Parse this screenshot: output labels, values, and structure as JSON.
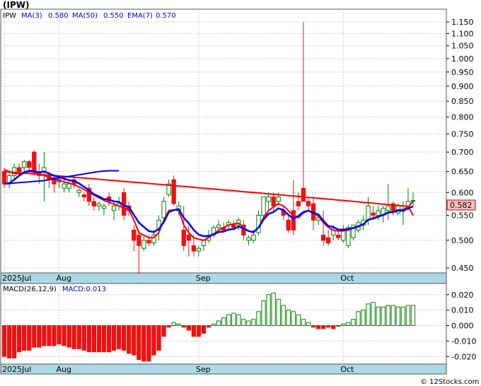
{
  "header": {
    "title": "(IPW)"
  },
  "legend": {
    "symbol": "IPW",
    "items": [
      {
        "label": "MA(3)",
        "value": "0.580",
        "color": "#ff0000"
      },
      {
        "label": "MA(50)",
        "value": "0.550",
        "color": "#0000cc"
      },
      {
        "label": "EMA(7)",
        "value": "0.570",
        "color": "#0000cc"
      }
    ]
  },
  "macd_legend": {
    "label": "MACD(26,12,9)",
    "value_label": "MACD:0.013"
  },
  "last_price": {
    "text": "0.582",
    "bg": "#ffc0c0"
  },
  "watermark": "© 12Stocks.com",
  "colors": {
    "up": "#008000",
    "down": "#ee1111",
    "ma": "#ff0000",
    "ema": "#0000ff",
    "axis_bar": "#add8e6"
  },
  "chart_data": [
    {
      "type": "candlestick",
      "title": "(IPW)",
      "ylim": [
        0.43,
        1.16
      ],
      "y_scale": "log",
      "y_ticks": [
        "1.150",
        "1.100",
        "1.050",
        "1.000",
        "0.950",
        "0.900",
        "0.850",
        "0.800",
        "0.750",
        "0.700",
        "0.650",
        "0.600",
        "0.550",
        "0.500",
        "0.450"
      ],
      "x_labels": [
        "2025Jul",
        "Aug",
        "Sep",
        "Oct"
      ],
      "x_label_index": [
        0,
        11,
        39,
        68
      ],
      "candles": [
        [
          0.65,
          0.66,
          0.61,
          0.62
        ],
        [
          0.62,
          0.65,
          0.61,
          0.64
        ],
        [
          0.64,
          0.67,
          0.63,
          0.66
        ],
        [
          0.66,
          0.67,
          0.64,
          0.65
        ],
        [
          0.66,
          0.68,
          0.65,
          0.675
        ],
        [
          0.675,
          0.68,
          0.65,
          0.66
        ],
        [
          0.7,
          0.705,
          0.64,
          0.65
        ],
        [
          0.65,
          0.67,
          0.62,
          0.64
        ],
        [
          0.65,
          0.7,
          0.58,
          0.66
        ],
        [
          0.64,
          0.65,
          0.61,
          0.63
        ],
        [
          0.635,
          0.64,
          0.6,
          0.62
        ],
        [
          0.625,
          0.64,
          0.61,
          0.63
        ],
        [
          0.61,
          0.63,
          0.6,
          0.62
        ],
        [
          0.61,
          0.63,
          0.6,
          0.62
        ],
        [
          0.63,
          0.64,
          0.61,
          0.62
        ],
        [
          0.6,
          0.61,
          0.59,
          0.605
        ],
        [
          0.595,
          0.6,
          0.58,
          0.59
        ],
        [
          0.61,
          0.62,
          0.57,
          0.58
        ],
        [
          0.58,
          0.59,
          0.56,
          0.57
        ],
        [
          0.57,
          0.58,
          0.56,
          0.575
        ],
        [
          0.565,
          0.575,
          0.55,
          0.57
        ],
        [
          0.59,
          0.6,
          0.57,
          0.58
        ],
        [
          0.56,
          0.58,
          0.54,
          0.57
        ],
        [
          0.57,
          0.59,
          0.56,
          0.575
        ],
        [
          0.6,
          0.61,
          0.54,
          0.55
        ],
        [
          0.57,
          0.58,
          0.55,
          0.56
        ],
        [
          0.52,
          0.53,
          0.48,
          0.5
        ],
        [
          0.51,
          0.52,
          0.44,
          0.49
        ],
        [
          0.485,
          0.51,
          0.48,
          0.5
        ],
        [
          0.5,
          0.51,
          0.49,
          0.495
        ],
        [
          0.495,
          0.52,
          0.49,
          0.51
        ],
        [
          0.52,
          0.55,
          0.5,
          0.54
        ],
        [
          0.545,
          0.59,
          0.54,
          0.58
        ],
        [
          0.595,
          0.63,
          0.59,
          0.62
        ],
        [
          0.63,
          0.64,
          0.57,
          0.575
        ],
        [
          0.56,
          0.58,
          0.55,
          0.57
        ],
        [
          0.52,
          0.57,
          0.48,
          0.49
        ],
        [
          0.51,
          0.53,
          0.47,
          0.5
        ],
        [
          0.49,
          0.51,
          0.47,
          0.48
        ],
        [
          0.48,
          0.49,
          0.47,
          0.485
        ],
        [
          0.49,
          0.5,
          0.48,
          0.5
        ],
        [
          0.5,
          0.52,
          0.495,
          0.51
        ],
        [
          0.51,
          0.53,
          0.505,
          0.525
        ],
        [
          0.525,
          0.54,
          0.52,
          0.53
        ],
        [
          0.525,
          0.535,
          0.515,
          0.52
        ],
        [
          0.53,
          0.54,
          0.52,
          0.535
        ],
        [
          0.53,
          0.54,
          0.52,
          0.525
        ],
        [
          0.53,
          0.545,
          0.52,
          0.54
        ],
        [
          0.53,
          0.54,
          0.5,
          0.51
        ],
        [
          0.5,
          0.51,
          0.49,
          0.505
        ],
        [
          0.5,
          0.52,
          0.495,
          0.51
        ],
        [
          0.515,
          0.56,
          0.51,
          0.55
        ],
        [
          0.55,
          0.59,
          0.545,
          0.59
        ],
        [
          0.58,
          0.6,
          0.56,
          0.59
        ],
        [
          0.59,
          0.6,
          0.56,
          0.57
        ],
        [
          0.58,
          0.6,
          0.57,
          0.59
        ],
        [
          0.56,
          0.57,
          0.54,
          0.55
        ],
        [
          0.54,
          0.55,
          0.515,
          0.52
        ],
        [
          0.56,
          0.63,
          0.51,
          0.52
        ],
        [
          0.58,
          0.6,
          0.56,
          0.57
        ],
        [
          0.61,
          1.15,
          0.58,
          0.58
        ],
        [
          0.58,
          0.59,
          0.56,
          0.57
        ],
        [
          0.575,
          0.59,
          0.52,
          0.54
        ],
        [
          0.54,
          0.55,
          0.53,
          0.545
        ],
        [
          0.51,
          0.56,
          0.49,
          0.5
        ],
        [
          0.505,
          0.52,
          0.49,
          0.495
        ],
        [
          0.51,
          0.53,
          0.5,
          0.52
        ],
        [
          0.51,
          0.52,
          0.5,
          0.505
        ],
        [
          0.5,
          0.53,
          0.495,
          0.52
        ],
        [
          0.49,
          0.53,
          0.485,
          0.525
        ],
        [
          0.505,
          0.53,
          0.5,
          0.53
        ],
        [
          0.52,
          0.54,
          0.515,
          0.535
        ],
        [
          0.53,
          0.55,
          0.52,
          0.54
        ],
        [
          0.54,
          0.59,
          0.53,
          0.57
        ],
        [
          0.555,
          0.57,
          0.545,
          0.55
        ],
        [
          0.55,
          0.57,
          0.54,
          0.56
        ],
        [
          0.55,
          0.57,
          0.535,
          0.565
        ],
        [
          0.56,
          0.62,
          0.54,
          0.57
        ],
        [
          0.575,
          0.58,
          0.55,
          0.56
        ],
        [
          0.555,
          0.575,
          0.55,
          0.57
        ],
        [
          0.56,
          0.58,
          0.53,
          0.56
        ],
        [
          0.57,
          0.61,
          0.56,
          0.58
        ],
        [
          0.582,
          0.6,
          0.57,
          0.582
        ]
      ],
      "ema7": [
        0.62,
        0.622,
        0.63,
        0.64,
        0.648,
        0.652,
        0.651,
        0.648,
        0.65,
        0.645,
        0.64,
        0.637,
        0.632,
        0.629,
        0.627,
        0.621,
        0.613,
        0.605,
        0.596,
        0.591,
        0.585,
        0.584,
        0.58,
        0.579,
        0.571,
        0.568,
        0.551,
        0.535,
        0.526,
        0.518,
        0.516,
        0.522,
        0.536,
        0.557,
        0.561,
        0.563,
        0.545,
        0.534,
        0.52,
        0.511,
        0.508,
        0.508,
        0.512,
        0.516,
        0.517,
        0.521,
        0.522,
        0.527,
        0.523,
        0.518,
        0.516,
        0.525,
        0.541,
        0.553,
        0.557,
        0.565,
        0.561,
        0.551,
        0.543,
        0.549,
        0.557,
        0.56,
        0.555,
        0.552,
        0.539,
        0.528,
        0.526,
        0.521,
        0.521,
        0.522,
        0.524,
        0.527,
        0.531,
        0.541,
        0.543,
        0.547,
        0.551,
        0.556,
        0.557,
        0.56,
        0.56,
        0.565,
        0.569
      ],
      "ma50": [
        0.62,
        0.621,
        0.622,
        0.623,
        0.624,
        0.625,
        0.626,
        0.627,
        0.628,
        0.63,
        0.632,
        0.634,
        0.636,
        0.638,
        0.64,
        0.642,
        0.644,
        0.646,
        0.648,
        0.65,
        0.651,
        0.652,
        0.652,
        0.652,
        null,
        null,
        null,
        null,
        null,
        null,
        null,
        null,
        null,
        null,
        null,
        null,
        null,
        null,
        null,
        null,
        null,
        null,
        null,
        null,
        null,
        null,
        null,
        null,
        null,
        null,
        null,
        null,
        null,
        null,
        null,
        null,
        null,
        null,
        null,
        null,
        null,
        null,
        null,
        null,
        null,
        null,
        null,
        null,
        null,
        null,
        null,
        null,
        null,
        null,
        null,
        null,
        null,
        null,
        null,
        null,
        null,
        null,
        null
      ],
      "ma3": [
        0.655,
        0.65,
        0.645,
        0.645,
        0.648,
        0.65,
        0.648,
        0.644,
        0.64,
        0.636,
        0.632,
        0.628,
        0.625,
        0.622,
        0.618,
        0.613,
        0.607,
        0.6,
        0.594,
        0.588,
        0.582,
        0.578,
        0.574,
        0.57,
        0.566,
        0.562,
        0.54,
        0.515,
        0.51,
        0.505,
        0.505,
        0.515,
        0.54,
        0.56,
        0.562,
        0.56,
        0.53,
        0.515,
        0.505,
        0.502,
        0.5,
        0.505,
        0.512,
        0.52,
        0.525,
        0.53,
        0.532,
        0.534,
        0.525,
        0.518,
        0.515,
        0.525,
        0.545,
        0.56,
        0.568,
        0.575,
        0.57,
        0.56,
        0.548,
        0.545,
        0.555,
        0.56,
        0.555,
        0.548,
        0.535,
        0.525,
        0.52,
        0.518,
        0.518,
        0.52,
        0.524,
        0.528,
        0.532,
        0.54,
        0.545,
        0.548,
        0.55,
        0.555,
        0.558,
        0.562,
        0.562,
        0.568,
        0.58
      ],
      "ma_red_long": [
        0.65,
        0.649,
        0.648,
        0.647,
        0.646,
        0.645,
        0.644,
        0.643,
        0.642,
        0.641,
        0.64,
        0.639,
        0.638,
        0.637,
        0.636,
        0.635,
        0.634,
        0.633,
        0.632,
        0.631,
        0.63,
        0.629,
        0.628,
        0.627,
        0.626,
        0.625,
        0.624,
        0.623,
        0.622,
        0.621,
        0.62,
        0.619,
        0.618,
        0.617,
        0.616,
        0.615,
        0.614,
        0.613,
        0.612,
        0.611,
        0.61,
        0.609,
        0.608,
        0.607,
        0.606,
        0.605,
        0.604,
        0.603,
        0.602,
        0.601,
        0.6,
        0.599,
        0.598,
        0.597,
        0.596,
        0.595,
        0.594,
        0.593,
        0.592,
        0.591,
        0.59,
        0.589,
        0.588,
        0.587,
        0.586,
        0.585,
        0.584,
        0.583,
        0.582,
        0.581,
        0.58,
        0.579,
        0.578,
        0.577,
        0.576,
        0.575,
        0.574,
        0.573,
        0.572,
        0.571,
        0.57,
        0.569,
        0.55
      ]
    },
    {
      "type": "bar",
      "title": "MACD(26,12,9)",
      "ylim": [
        -0.024,
        0.024
      ],
      "y_ticks": [
        "0.020",
        "0.010",
        "0.000",
        "-0.010",
        "-0.020"
      ],
      "x_labels": [
        "2025Jul",
        "Aug",
        "Sep",
        "Oct"
      ],
      "values": [
        -0.02,
        -0.021,
        -0.021,
        -0.017,
        -0.016,
        -0.016,
        -0.014,
        -0.014,
        -0.013,
        -0.013,
        -0.013,
        -0.012,
        -0.013,
        -0.014,
        -0.015,
        -0.015,
        -0.016,
        -0.017,
        -0.017,
        -0.017,
        -0.017,
        -0.017,
        -0.016,
        -0.015,
        -0.016,
        -0.018,
        -0.019,
        -0.022,
        -0.023,
        -0.023,
        -0.019,
        -0.016,
        -0.007,
        -0.001,
        0.002,
        0.001,
        -0.001,
        -0.003,
        -0.007,
        -0.007,
        -0.005,
        -0.001,
        0.001,
        0.003,
        0.005,
        0.007,
        0.008,
        0.007,
        0.004,
        0.003,
        0.004,
        0.009,
        0.016,
        0.02,
        0.021,
        0.017,
        0.013,
        0.01,
        0.009,
        0.007,
        0.004,
        0.002,
        -0.001,
        -0.002,
        -0.002,
        -0.001,
        -0.002,
        0.0,
        0.001,
        0.002,
        0.004,
        0.009,
        0.01,
        0.014,
        0.015,
        0.012,
        0.012,
        0.013,
        0.013,
        0.012,
        0.012,
        0.013,
        0.013
      ]
    }
  ]
}
